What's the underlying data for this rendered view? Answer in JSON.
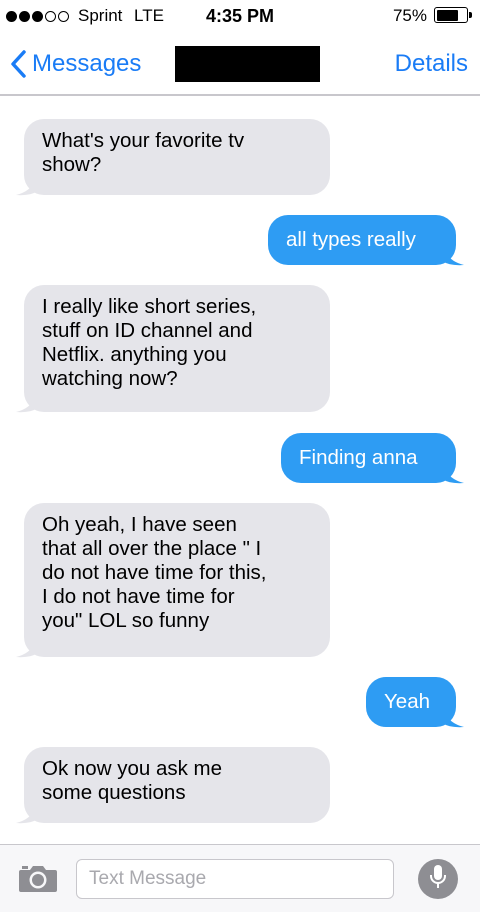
{
  "status_bar": {
    "carrier": "Sprint",
    "network": "LTE",
    "time": "4:35 PM",
    "battery": "75%",
    "battery_level": 0.75,
    "signal_bars_filled": 3,
    "signal_bars_total": 5
  },
  "nav": {
    "back_label": "Messages",
    "details_label": "Details"
  },
  "messages": [
    {
      "direction": "incoming",
      "lines": [
        "What's your favorite tv",
        "show?"
      ]
    },
    {
      "direction": "outgoing",
      "lines": [
        "all types really"
      ]
    },
    {
      "direction": "incoming",
      "lines": [
        "I really like short series,",
        "stuff on ID channel and",
        "Netflix. anything you",
        "watching now?"
      ]
    },
    {
      "direction": "outgoing",
      "lines": [
        "Finding anna"
      ]
    },
    {
      "direction": "incoming",
      "lines": [
        "Oh yeah, I have seen",
        "that all over the place \" I",
        "do not have time for this,",
        "I do not have time for",
        "you\" LOL so funny"
      ]
    },
    {
      "direction": "outgoing",
      "lines": [
        "Yeah"
      ]
    },
    {
      "direction": "incoming",
      "lines": [
        "Ok now you ask me",
        "some questions"
      ]
    }
  ],
  "composer": {
    "placeholder": "Text Message"
  },
  "colors": {
    "accent": "#1a7cf6",
    "outgoing_bubble": "#2e9cf3",
    "incoming_bubble": "#e5e5ea"
  },
  "icons": {
    "back": "chevron-left-icon",
    "camera": "camera-icon",
    "mic": "microphone-icon"
  }
}
